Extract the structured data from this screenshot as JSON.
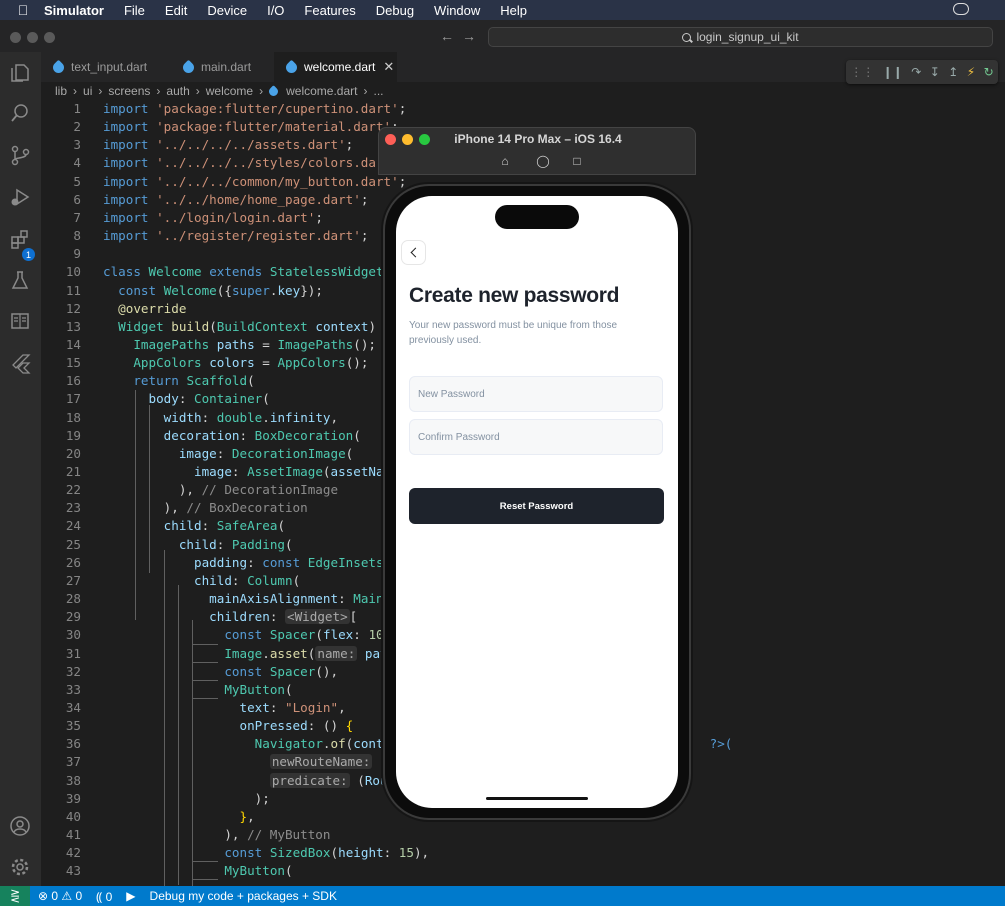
{
  "menubar": {
    "app": "Simulator",
    "items": [
      "File",
      "Edit",
      "Device",
      "I/O",
      "Features",
      "Debug",
      "Window",
      "Help"
    ]
  },
  "search": {
    "text": "login_signup_ui_kit"
  },
  "tabs": [
    {
      "label": "text_input.dart"
    },
    {
      "label": "main.dart"
    },
    {
      "label": "welcome.dart"
    }
  ],
  "breadcrumb": [
    "lib",
    "ui",
    "screens",
    "auth",
    "welcome",
    "welcome.dart",
    "..."
  ],
  "activity": {
    "debug_badge": "1"
  },
  "simulator": {
    "title": "iPhone 14 Pro Max – iOS 16.4"
  },
  "screen": {
    "heading": "Create new password",
    "subtext": "Your new password must be unique from those previously used.",
    "new_password_placeholder": "New Password",
    "confirm_password_placeholder": "Confirm Password",
    "reset_button": "Reset Password"
  },
  "statusbar": {
    "problems": "0 ⚠ 0",
    "ports": "0",
    "launch": "Debug my code + packages + SDK"
  },
  "colors": {
    "statusbar": "#007acc",
    "menubar": "#2a3347",
    "button": "#1e232c"
  }
}
